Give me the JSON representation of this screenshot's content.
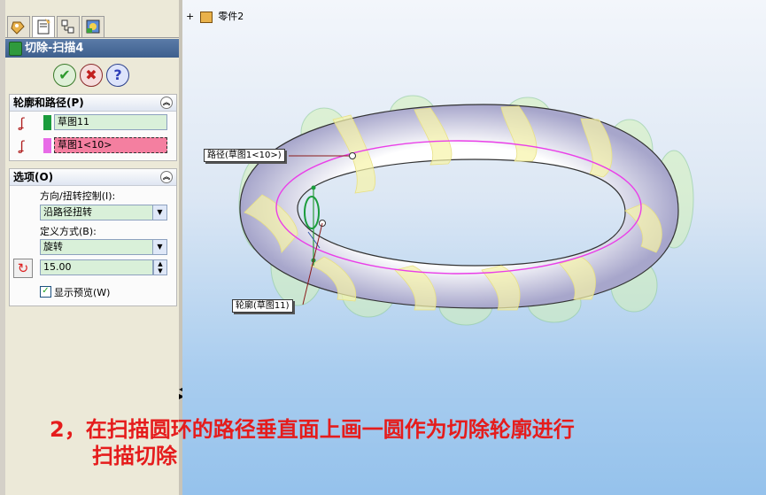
{
  "header": {
    "title": "切除-扫描4"
  },
  "buttons": {
    "ok": "✔",
    "cancel": "✖",
    "help": "?"
  },
  "profile_path_group": {
    "title": "轮廓和路径(P)",
    "profile_value": "草图11",
    "path_value": "草图1<10>"
  },
  "options_group": {
    "title": "选项(O)",
    "orientation_label": "方向/扭转控制(I):",
    "orientation_value": "沿路径扭转",
    "define_label": "定义方式(B):",
    "define_value": "旋转",
    "angle_value": "15.00",
    "preview_label": "显示预览(W)"
  },
  "tree": {
    "part_label": "零件2"
  },
  "callouts": {
    "path": "路径(草图1<10>)",
    "profile": "轮廓(草图11)"
  },
  "note": {
    "line1": "2，在扫描圆环的路径垂直面上画一圆作为切除轮廓进行",
    "line2": "扫描切除"
  },
  "colors": {
    "path_highlight": "#f47fa0",
    "profile_highlight": "#1a9c3c",
    "note_text": "#e51c1c",
    "path_sketch": "#ea3ee8"
  }
}
